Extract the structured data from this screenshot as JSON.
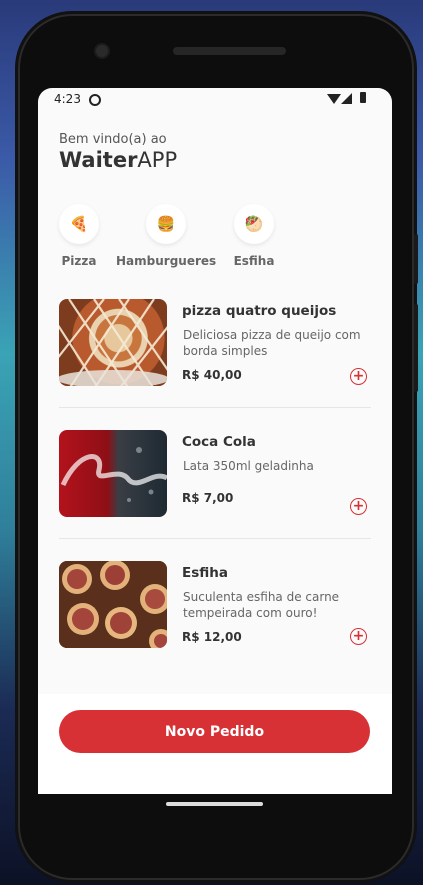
{
  "status": {
    "time": "4:23"
  },
  "header": {
    "greeting": "Bem vindo(a) ao",
    "brand_bold": "Waiter",
    "brand_light": "APP"
  },
  "categories": [
    {
      "icon": "🍕",
      "label": "Pizza"
    },
    {
      "icon": "🍔",
      "label": "Hamburgueres"
    },
    {
      "icon": "🥙",
      "label": "Esfiha"
    }
  ],
  "items": [
    {
      "name": "pizza quatro queijos",
      "description": " Deliciosa pizza de queijo com borda simples",
      "price": "R$ 40,00"
    },
    {
      "name": "Coca Cola",
      "description": " Lata 350ml geladinha",
      "price": "R$ 7,00"
    },
    {
      "name": "Esfiha",
      "description": " Suculenta esfiha de carne tempeirada com ouro!",
      "price": "R$ 12,00"
    }
  ],
  "footer": {
    "button_label": "Novo Pedido"
  },
  "colors": {
    "accent": "#d73035",
    "background": "#fafafa",
    "text": "#333333"
  },
  "icons": {
    "add": "plus-circle-icon"
  }
}
